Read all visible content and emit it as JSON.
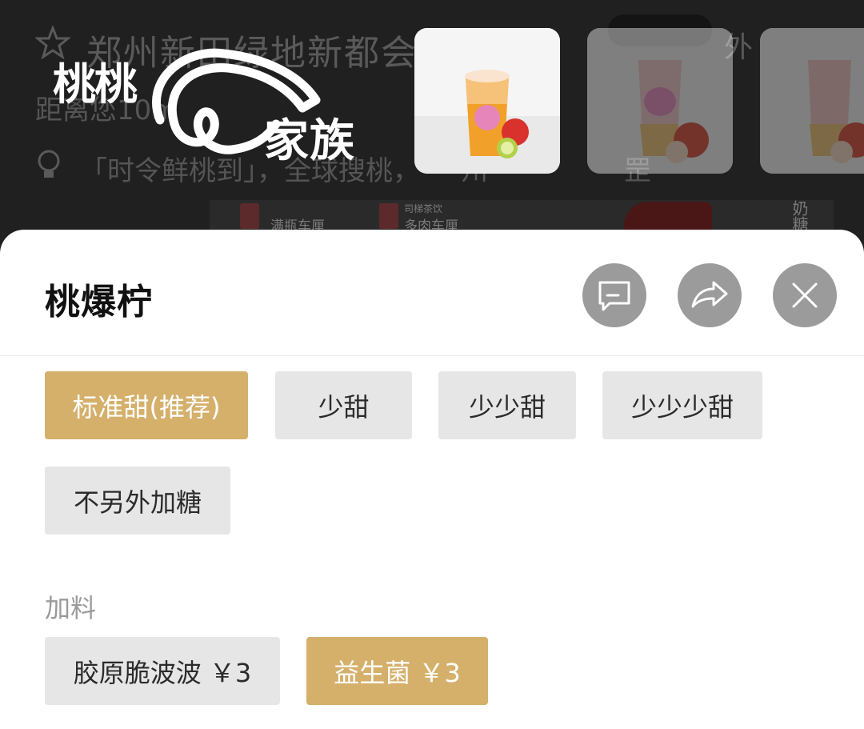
{
  "background": {
    "store_name": "郑州新田绿地新都会",
    "store_extra": "外",
    "distance": "距离您10m",
    "notice": "「时令鲜桃到」，全球搜桃，　　州　　　　　罡",
    "banner_items": [
      "满瓶车厘",
      "多肉车厘",
      "司梯茶饮",
      "奶糖"
    ],
    "brand_word_1": "桃桃",
    "brand_word_2": "家族"
  },
  "sheet": {
    "title": "桃爆柠",
    "sweetness_options": [
      {
        "label": "标准甜(推荐)",
        "selected": true
      },
      {
        "label": "少甜",
        "selected": false
      },
      {
        "label": "少少甜",
        "selected": false
      },
      {
        "label": "少少少甜",
        "selected": false
      },
      {
        "label": "不另外加糖",
        "selected": false
      }
    ],
    "toppings_label": "加料",
    "topping_options": [
      {
        "label": "胶原脆波波 ￥3",
        "selected": false
      },
      {
        "label": "益生菌 ￥3",
        "selected": true
      }
    ]
  },
  "icons": {
    "comment": "comment-icon",
    "share": "share-icon",
    "close": "close-icon",
    "star": "star-icon",
    "bulb": "lightbulb-icon"
  },
  "colors": {
    "selected_chip": "#d5b06b",
    "unselected_chip": "#e6e6e6",
    "icon_button": "#9b9b9b",
    "overlay": "#202020"
  }
}
